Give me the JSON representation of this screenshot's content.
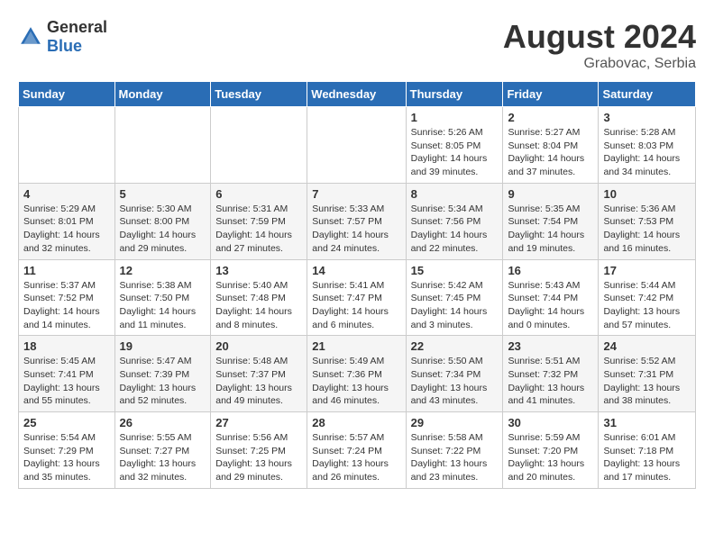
{
  "header": {
    "logo_general": "General",
    "logo_blue": "Blue",
    "month_year": "August 2024",
    "location": "Grabovac, Serbia"
  },
  "weekdays": [
    "Sunday",
    "Monday",
    "Tuesday",
    "Wednesday",
    "Thursday",
    "Friday",
    "Saturday"
  ],
  "weeks": [
    [
      {
        "day": "",
        "info": ""
      },
      {
        "day": "",
        "info": ""
      },
      {
        "day": "",
        "info": ""
      },
      {
        "day": "",
        "info": ""
      },
      {
        "day": "1",
        "info": "Sunrise: 5:26 AM\nSunset: 8:05 PM\nDaylight: 14 hours\nand 39 minutes."
      },
      {
        "day": "2",
        "info": "Sunrise: 5:27 AM\nSunset: 8:04 PM\nDaylight: 14 hours\nand 37 minutes."
      },
      {
        "day": "3",
        "info": "Sunrise: 5:28 AM\nSunset: 8:03 PM\nDaylight: 14 hours\nand 34 minutes."
      }
    ],
    [
      {
        "day": "4",
        "info": "Sunrise: 5:29 AM\nSunset: 8:01 PM\nDaylight: 14 hours\nand 32 minutes."
      },
      {
        "day": "5",
        "info": "Sunrise: 5:30 AM\nSunset: 8:00 PM\nDaylight: 14 hours\nand 29 minutes."
      },
      {
        "day": "6",
        "info": "Sunrise: 5:31 AM\nSunset: 7:59 PM\nDaylight: 14 hours\nand 27 minutes."
      },
      {
        "day": "7",
        "info": "Sunrise: 5:33 AM\nSunset: 7:57 PM\nDaylight: 14 hours\nand 24 minutes."
      },
      {
        "day": "8",
        "info": "Sunrise: 5:34 AM\nSunset: 7:56 PM\nDaylight: 14 hours\nand 22 minutes."
      },
      {
        "day": "9",
        "info": "Sunrise: 5:35 AM\nSunset: 7:54 PM\nDaylight: 14 hours\nand 19 minutes."
      },
      {
        "day": "10",
        "info": "Sunrise: 5:36 AM\nSunset: 7:53 PM\nDaylight: 14 hours\nand 16 minutes."
      }
    ],
    [
      {
        "day": "11",
        "info": "Sunrise: 5:37 AM\nSunset: 7:52 PM\nDaylight: 14 hours\nand 14 minutes."
      },
      {
        "day": "12",
        "info": "Sunrise: 5:38 AM\nSunset: 7:50 PM\nDaylight: 14 hours\nand 11 minutes."
      },
      {
        "day": "13",
        "info": "Sunrise: 5:40 AM\nSunset: 7:48 PM\nDaylight: 14 hours\nand 8 minutes."
      },
      {
        "day": "14",
        "info": "Sunrise: 5:41 AM\nSunset: 7:47 PM\nDaylight: 14 hours\nand 6 minutes."
      },
      {
        "day": "15",
        "info": "Sunrise: 5:42 AM\nSunset: 7:45 PM\nDaylight: 14 hours\nand 3 minutes."
      },
      {
        "day": "16",
        "info": "Sunrise: 5:43 AM\nSunset: 7:44 PM\nDaylight: 14 hours\nand 0 minutes."
      },
      {
        "day": "17",
        "info": "Sunrise: 5:44 AM\nSunset: 7:42 PM\nDaylight: 13 hours\nand 57 minutes."
      }
    ],
    [
      {
        "day": "18",
        "info": "Sunrise: 5:45 AM\nSunset: 7:41 PM\nDaylight: 13 hours\nand 55 minutes."
      },
      {
        "day": "19",
        "info": "Sunrise: 5:47 AM\nSunset: 7:39 PM\nDaylight: 13 hours\nand 52 minutes."
      },
      {
        "day": "20",
        "info": "Sunrise: 5:48 AM\nSunset: 7:37 PM\nDaylight: 13 hours\nand 49 minutes."
      },
      {
        "day": "21",
        "info": "Sunrise: 5:49 AM\nSunset: 7:36 PM\nDaylight: 13 hours\nand 46 minutes."
      },
      {
        "day": "22",
        "info": "Sunrise: 5:50 AM\nSunset: 7:34 PM\nDaylight: 13 hours\nand 43 minutes."
      },
      {
        "day": "23",
        "info": "Sunrise: 5:51 AM\nSunset: 7:32 PM\nDaylight: 13 hours\nand 41 minutes."
      },
      {
        "day": "24",
        "info": "Sunrise: 5:52 AM\nSunset: 7:31 PM\nDaylight: 13 hours\nand 38 minutes."
      }
    ],
    [
      {
        "day": "25",
        "info": "Sunrise: 5:54 AM\nSunset: 7:29 PM\nDaylight: 13 hours\nand 35 minutes."
      },
      {
        "day": "26",
        "info": "Sunrise: 5:55 AM\nSunset: 7:27 PM\nDaylight: 13 hours\nand 32 minutes."
      },
      {
        "day": "27",
        "info": "Sunrise: 5:56 AM\nSunset: 7:25 PM\nDaylight: 13 hours\nand 29 minutes."
      },
      {
        "day": "28",
        "info": "Sunrise: 5:57 AM\nSunset: 7:24 PM\nDaylight: 13 hours\nand 26 minutes."
      },
      {
        "day": "29",
        "info": "Sunrise: 5:58 AM\nSunset: 7:22 PM\nDaylight: 13 hours\nand 23 minutes."
      },
      {
        "day": "30",
        "info": "Sunrise: 5:59 AM\nSunset: 7:20 PM\nDaylight: 13 hours\nand 20 minutes."
      },
      {
        "day": "31",
        "info": "Sunrise: 6:01 AM\nSunset: 7:18 PM\nDaylight: 13 hours\nand 17 minutes."
      }
    ]
  ]
}
